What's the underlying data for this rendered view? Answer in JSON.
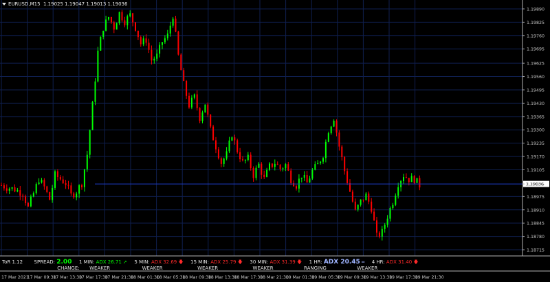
{
  "window": {
    "symbol": "EURUSD,M15",
    "ohlc": "1.19025 1.19047 1.19013 1.19036"
  },
  "chart_data": {
    "type": "candlestick",
    "symbol": "EURUSD",
    "timeframe": "M15",
    "last_price": "1.19036",
    "price_labels": [
      "1.19890",
      "1.19825",
      "1.19760",
      "1.19695",
      "1.19625",
      "1.19560",
      "1.19495",
      "1.19430",
      "1.19365",
      "1.19300",
      "1.19235",
      "1.19170",
      "1.19105",
      "1.19036",
      "1.18975",
      "1.18910",
      "1.18845",
      "1.18780",
      "1.18715"
    ],
    "time_labels": [
      "17 Mar 2021",
      "17 Mar 09:30",
      "17 Mar 13:30",
      "17 Mar 17:30",
      "17 Mar 21:30",
      "18 Mar 01:30",
      "18 Mar 05:30",
      "18 Mar 09:30",
      "18 Mar 13:30",
      "18 Mar 17:30",
      "18 Mar 21:30",
      "19 Mar 01:30",
      "19 Mar 05:30",
      "19 Mar 09:30",
      "19 Mar 13:30",
      "19 Mar 17:30",
      "19 Mar 21:30"
    ],
    "price_range": [
      1.18705,
      1.1992
    ],
    "bull_color": "#00ff00",
    "bear_color": "#ff0000",
    "grid": true,
    "grid_color": "#0f1f4f",
    "price_line_color": "#1e3cc8",
    "close_path": [
      [
        0,
        1.1903
      ],
      [
        2,
        1.1902
      ],
      [
        5,
        1.1901
      ],
      [
        8,
        1.1899
      ],
      [
        10,
        1.1892
      ],
      [
        12,
        1.1899
      ],
      [
        14,
        1.1906
      ],
      [
        16,
        1.1902
      ],
      [
        18,
        1.1896
      ],
      [
        20,
        1.1908
      ],
      [
        22,
        1.1906
      ],
      [
        24,
        1.1904
      ],
      [
        26,
        1.1898
      ],
      [
        28,
        1.19
      ],
      [
        30,
        1.1904
      ],
      [
        32,
        1.1918
      ],
      [
        34,
        1.1942
      ],
      [
        36,
        1.1968
      ],
      [
        38,
        1.198
      ],
      [
        40,
        1.1985
      ],
      [
        42,
        1.198
      ],
      [
        44,
        1.1987
      ],
      [
        46,
        1.1983
      ],
      [
        48,
        1.1986
      ],
      [
        50,
        1.198
      ],
      [
        52,
        1.1972
      ],
      [
        54,
        1.1974
      ],
      [
        56,
        1.1964
      ],
      [
        58,
        1.1966
      ],
      [
        60,
        1.1973
      ],
      [
        62,
        1.1976
      ],
      [
        64,
        1.1986
      ],
      [
        66,
        1.1966
      ],
      [
        68,
        1.1952
      ],
      [
        70,
        1.1942
      ],
      [
        72,
        1.1946
      ],
      [
        74,
        1.1936
      ],
      [
        76,
        1.1943
      ],
      [
        78,
        1.193
      ],
      [
        80,
        1.1922
      ],
      [
        82,
        1.1914
      ],
      [
        84,
        1.1918
      ],
      [
        86,
        1.1928
      ],
      [
        88,
        1.192
      ],
      [
        90,
        1.1914
      ],
      [
        92,
        1.1916
      ],
      [
        94,
        1.1908
      ],
      [
        96,
        1.1913
      ],
      [
        98,
        1.1906
      ],
      [
        100,
        1.1912
      ],
      [
        102,
        1.1914
      ],
      [
        104,
        1.1911
      ],
      [
        106,
        1.1913
      ],
      [
        108,
        1.1906
      ],
      [
        110,
        1.1903
      ],
      [
        112,
        1.1908
      ],
      [
        114,
        1.1904
      ],
      [
        116,
        1.191
      ],
      [
        118,
        1.1913
      ],
      [
        120,
        1.1918
      ],
      [
        122,
        1.193
      ],
      [
        124,
        1.1936
      ],
      [
        126,
        1.1922
      ],
      [
        128,
        1.191
      ],
      [
        130,
        1.19
      ],
      [
        132,
        1.189
      ],
      [
        134,
        1.1895
      ],
      [
        136,
        1.1898
      ],
      [
        138,
        1.1892
      ],
      [
        140,
        1.1878
      ],
      [
        142,
        1.188
      ],
      [
        144,
        1.1888
      ],
      [
        146,
        1.1895
      ],
      [
        148,
        1.1904
      ],
      [
        150,
        1.1908
      ],
      [
        152,
        1.1906
      ],
      [
        154,
        1.1906
      ],
      [
        156,
        1.1903
      ]
    ]
  },
  "indicator": {
    "name": "ToR 1.12",
    "spread_label": "SPREAD:",
    "spread_value": "2.00",
    "change_label": "CHANGE:",
    "tf_1min": "1 MIN:",
    "adx_1min": "ADX 26.71",
    "arrow_1min": "➚",
    "state_1min": "WEAKER",
    "tf_5min": "5 MIN:",
    "adx_5min": "ADX 32.69",
    "arrow_5min": "🡇",
    "state_5min": "WEAKER",
    "tf_15min": "15 MIN:",
    "adx_15min": "ADX 25.79",
    "arrow_15min": "🡇",
    "state_15min": "WEAKER",
    "tf_30min": "30 MIN:",
    "adx_30min": "ADX 31.39",
    "arrow_30min": "🡇",
    "state_30min": "WEAKER",
    "tf_1hr": "1 HR:",
    "adx_1hr": "ADX 20.45",
    "arrow_1hr": "═",
    "state_1hr": "RANGING",
    "tf_4hr": "4 HR:",
    "adx_4hr": "ADX 31.40",
    "arrow_4hr": "🡇",
    "state_4hr": "WEAKER",
    "colors": {
      "up": "#00ff00",
      "down": "#ff2a2a",
      "neutral": "#9fb4ff"
    }
  }
}
